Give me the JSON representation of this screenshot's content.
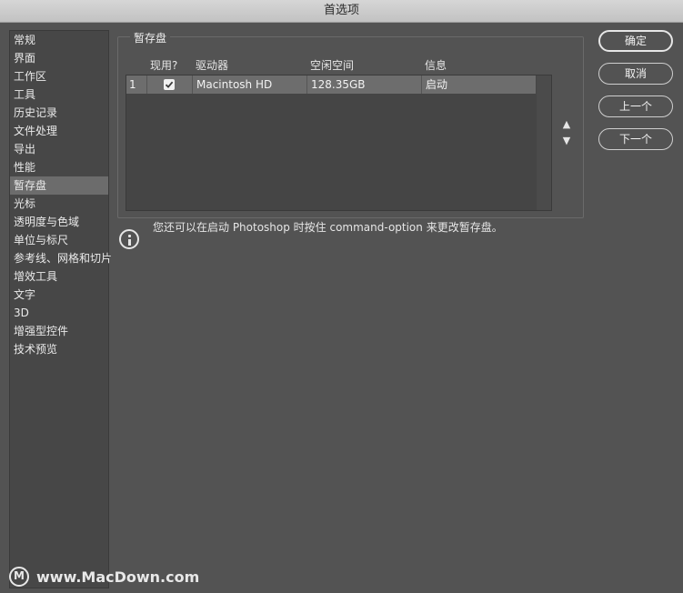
{
  "window": {
    "title": "首选项"
  },
  "sidebar": {
    "items": [
      {
        "label": "常规"
      },
      {
        "label": "界面"
      },
      {
        "label": "工作区"
      },
      {
        "label": "工具"
      },
      {
        "label": "历史记录"
      },
      {
        "label": "文件处理"
      },
      {
        "label": "导出"
      },
      {
        "label": "性能"
      },
      {
        "label": "暂存盘",
        "selected": true
      },
      {
        "label": "光标"
      },
      {
        "label": "透明度与色域"
      },
      {
        "label": "单位与标尺"
      },
      {
        "label": "参考线、网格和切片"
      },
      {
        "label": "增效工具"
      },
      {
        "label": "文字"
      },
      {
        "label": "3D"
      },
      {
        "label": "增强型控件"
      },
      {
        "label": "技术预览"
      }
    ]
  },
  "scratch": {
    "group_label": "暂存盘",
    "columns": [
      "现用?",
      "驱动器",
      "空闲空间",
      "信息"
    ],
    "rows": [
      {
        "index": "1",
        "active": true,
        "drive": "Macintosh HD",
        "free": "128.35GB",
        "info": "启动"
      }
    ],
    "hint": "您还可以在启动 Photoshop 时按住 command-option 来更改暂存盘。"
  },
  "buttons": {
    "ok": "确定",
    "cancel": "取消",
    "prev": "上一个",
    "next": "下一个"
  },
  "icons": {
    "up": "▲",
    "down": "▼",
    "info": "info-icon",
    "check": "checkmark-icon"
  },
  "watermark": {
    "text": "www.MacDown.com",
    "logo": "M"
  }
}
